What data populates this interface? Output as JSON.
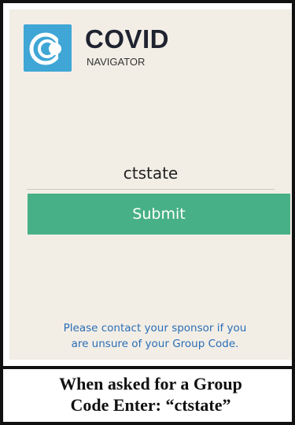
{
  "app": {
    "brand_title": "COVID",
    "brand_subtitle": "NAVIGATOR",
    "logo_icon": "covid-navigator-logo",
    "colors": {
      "logo_bg": "#3fa6d6",
      "submit_bg": "#48b086",
      "link_text": "#2a6db5",
      "screen_bg": "#f2eee6"
    }
  },
  "form": {
    "group_code_value": "ctstate",
    "submit_label": "Submit"
  },
  "notes": {
    "contact_line1": "Please contact your sponsor if you",
    "contact_line2": "are unsure of your Group Code."
  },
  "caption": {
    "line1": "When asked for a Group",
    "line2": "Code Enter: “ctstate”"
  }
}
